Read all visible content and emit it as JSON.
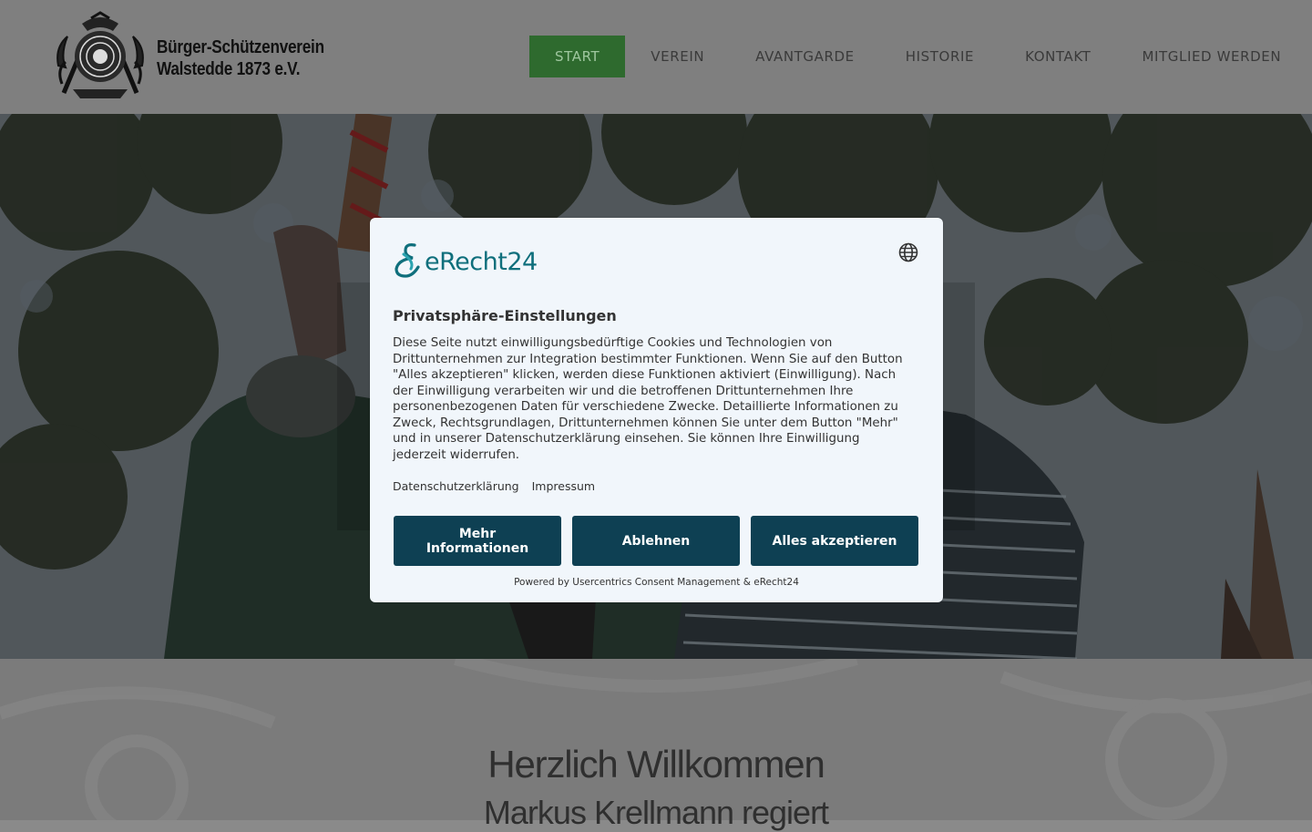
{
  "header": {
    "logo_line1": "Bürger-Schützenverein",
    "logo_line2": "Walstedde 1873 e.V.",
    "nav": [
      {
        "label": "START",
        "active": true
      },
      {
        "label": "VEREIN"
      },
      {
        "label": "AVANTGARDE"
      },
      {
        "label": "HISTORIE"
      },
      {
        "label": "KONTAKT"
      },
      {
        "label": "MITGLIED WERDEN"
      }
    ]
  },
  "main": {
    "welcome_title": "Herzlich Willkommen",
    "welcome_subtitle": "Markus Krellmann regiert"
  },
  "consent": {
    "brand": "eRecht24",
    "language_icon": "globe-icon",
    "title": "Privatsphäre-Einstellungen",
    "body": "Diese Seite nutzt einwilligungsbedürftige Cookies und Technologien von Drittunternehmen zur Integration bestimmter Funktionen. Wenn Sie auf den Button \"Alles akzeptieren\" klicken, werden diese Funktionen aktiviert (Einwilligung). Nach der Einwilligung verarbeiten wir und die betroffenen Drittunternehmen Ihre personenbezogenen Daten für verschiedene Zwecke. Detaillierte Informationen zu Zweck, Rechtsgrundlagen, Drittunternehmen können Sie unter dem Button \"Mehr\" und in unserer Datenschutzerklärung einsehen. Sie können Ihre Einwilligung jederzeit widerrufen.",
    "link_privacy": "Datenschutzerklärung",
    "link_imprint": "Impressum",
    "btn_more": "Mehr Informationen",
    "btn_deny": "Ablehnen",
    "btn_accept": "Alles akzeptieren",
    "powered_by": "Powered by Usercentrics Consent Management & eRecht24"
  },
  "colors": {
    "nav_active_bg": "#2e6a2e",
    "button_bg": "#0e4053",
    "brand_teal": "#0f6f7c",
    "modal_bg": "#f1f6fb"
  }
}
